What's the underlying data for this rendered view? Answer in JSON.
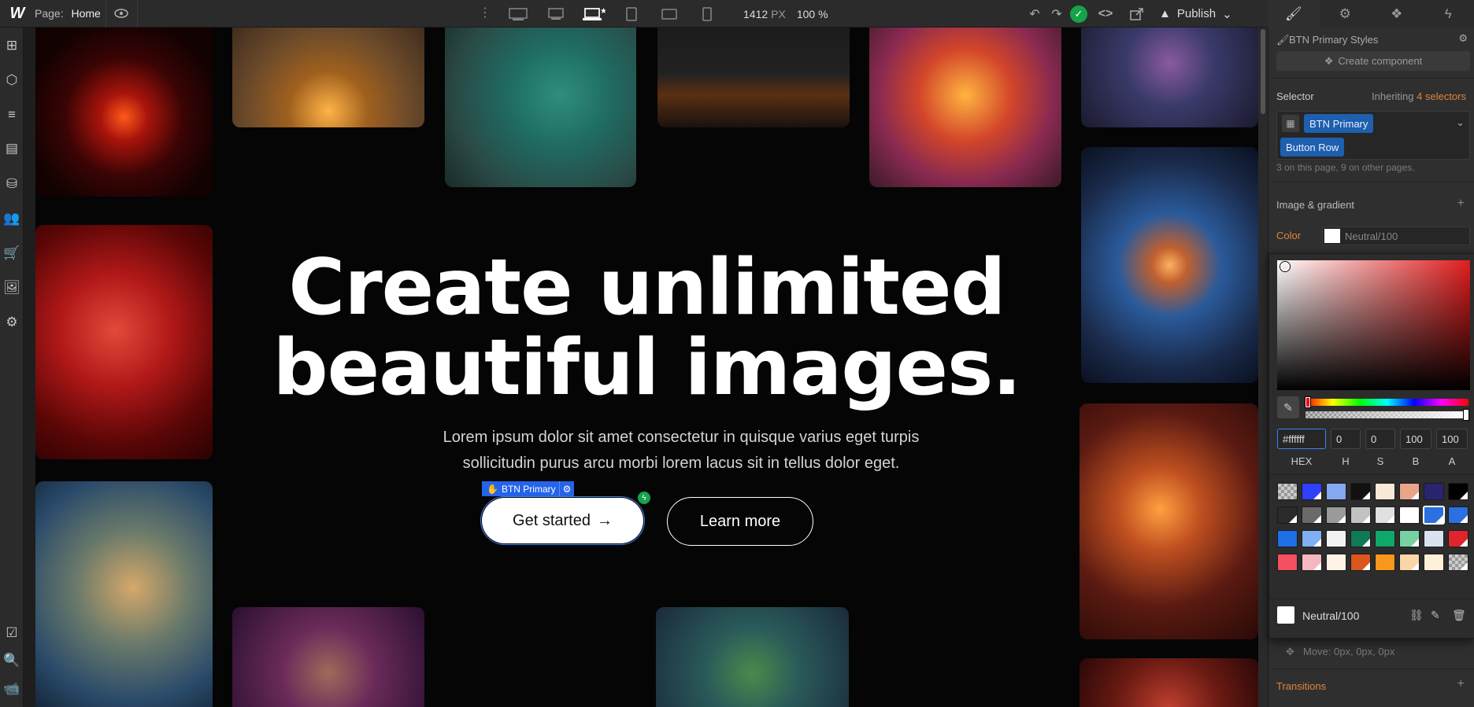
{
  "topbar": {
    "logo": "W",
    "page_label": "Page:",
    "page_name": "Home",
    "width_value": "1412",
    "width_unit": "PX",
    "zoom": "100 %",
    "publish_label": "Publish"
  },
  "canvas": {
    "hero_title_line1": "Create unlimited",
    "hero_title_line2": "beautiful images.",
    "hero_sub_line1": "Lorem ipsum dolor sit amet consectetur in quisque varius eget turpis",
    "hero_sub_line2": "sollicitudin purus arcu morbi lorem lacus sit in tellus dolor eget.",
    "primary_button": "Get started",
    "primary_arrow": "→",
    "secondary_button": "Learn more",
    "selected_element_tag": "BTN Primary"
  },
  "panel": {
    "styles_title": "BTN Primary Styles",
    "create_component": "Create component",
    "selector_label": "Selector",
    "inheriting_label": "Inheriting",
    "inheriting_count": "4 selectors",
    "selectors": [
      "BTN Primary",
      "Button Row"
    ],
    "usage_note": "3 on this page, 9 on other pages.",
    "image_gradient_title": "Image & gradient",
    "color_label": "Color",
    "color_value": "Neutral/100",
    "picker": {
      "hex": "#ffffff",
      "h": "0",
      "s": "0",
      "b": "100",
      "a": "100",
      "labels": [
        "HEX",
        "H",
        "S",
        "B",
        "A"
      ],
      "swatch_name": "Neutral/100"
    },
    "move_label": "Move: 0px, 0px, 0px",
    "transitions_title": "Transitions"
  },
  "colors": {
    "accent": "#2563eb",
    "success": "#16a34a",
    "panel_bg": "#2f2f2f",
    "canvas_bg": "#050505"
  }
}
